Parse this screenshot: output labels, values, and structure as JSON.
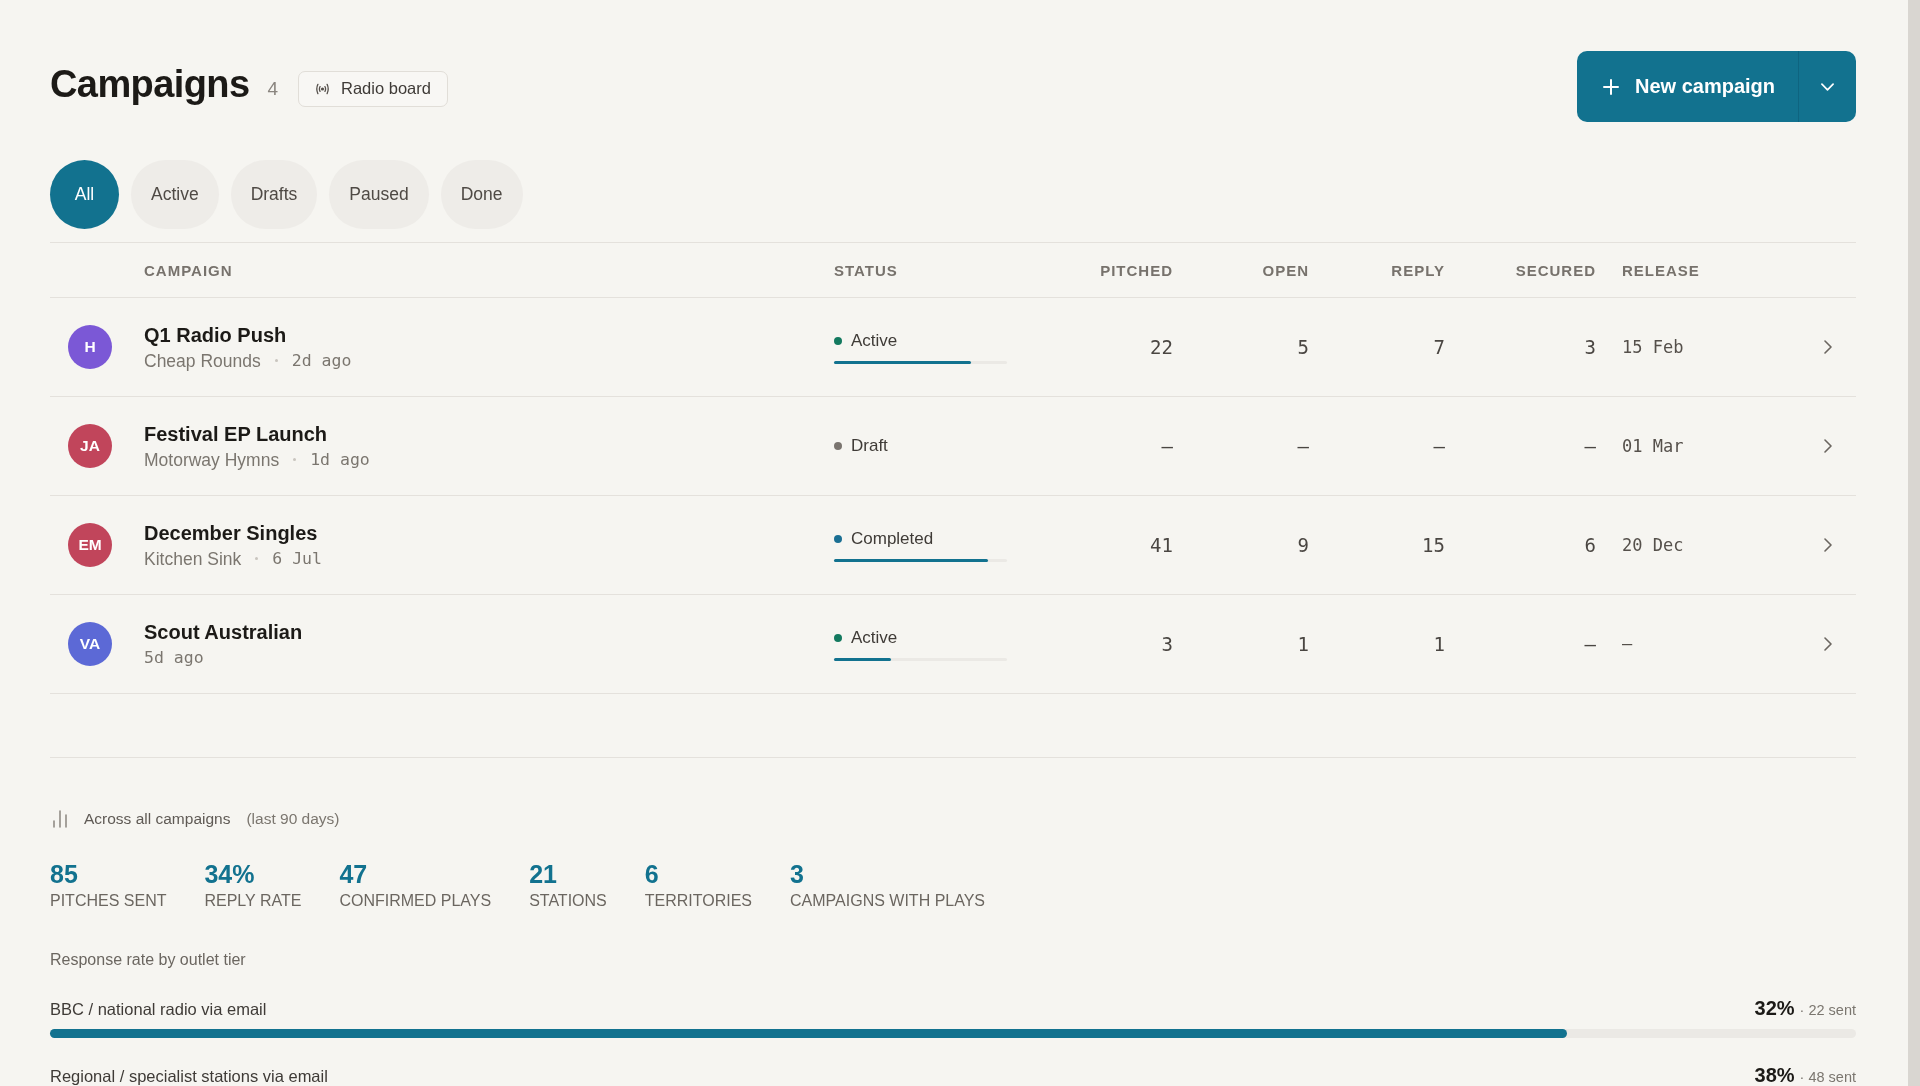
{
  "header": {
    "title": "Campaigns",
    "count": "4",
    "board_button": {
      "label": "Radio board"
    },
    "new_button": {
      "label": "New campaign"
    }
  },
  "filters": [
    {
      "label": "All",
      "selected": true
    },
    {
      "label": "Active",
      "selected": false
    },
    {
      "label": "Drafts",
      "selected": false
    },
    {
      "label": "Paused",
      "selected": false
    },
    {
      "label": "Done",
      "selected": false
    }
  ],
  "table": {
    "columns": [
      "CAMPAIGN",
      "STATUS",
      "PITCHED",
      "OPEN",
      "REPLY",
      "SECURED",
      "RELEASE"
    ],
    "rows": [
      {
        "avatar": {
          "initials": "H",
          "color": "#7b58d6"
        },
        "name": "Q1 Radio Push",
        "meta": [
          {
            "kind": "artist",
            "text": "Cheap Rounds"
          },
          {
            "kind": "time",
            "text": "2d ago"
          }
        ],
        "status": {
          "label": "Active",
          "color": "#13795f",
          "level": 0.79
        },
        "pitched": "22",
        "open": "5",
        "reply": "7",
        "secured": "3",
        "release": "15 Feb"
      },
      {
        "avatar": {
          "initials": "JA",
          "color": "#c1455b"
        },
        "name": "Festival EP Launch",
        "meta": [
          {
            "kind": "artist",
            "text": "Motorway Hymns"
          },
          {
            "kind": "time",
            "text": "1d ago"
          }
        ],
        "status": {
          "label": "Draft",
          "color": "#7a746f"
        },
        "pitched": "—",
        "open": "—",
        "reply": "—",
        "secured": "—",
        "release": "01 Mar"
      },
      {
        "avatar": {
          "initials": "EM",
          "color": "#c1455b"
        },
        "name": "December Singles",
        "meta": [
          {
            "kind": "artist",
            "text": "Kitchen Sink"
          },
          {
            "kind": "time",
            "text": "6 Jul"
          }
        ],
        "status": {
          "label": "Completed",
          "color": "#1a6f93",
          "level": 0.89
        },
        "pitched": "41",
        "open": "9",
        "reply": "15",
        "secured": "6",
        "release": "20 Dec"
      },
      {
        "avatar": {
          "initials": "VA",
          "color": "#5c69d6"
        },
        "name": "Scout Australian",
        "meta": [
          {
            "kind": "time",
            "text": "5d ago"
          }
        ],
        "status": {
          "label": "Active",
          "color": "#13795f",
          "level": 0.33
        },
        "pitched": "3",
        "open": "1",
        "reply": "1",
        "secured": "—",
        "release": "–"
      }
    ]
  },
  "summary": {
    "title": "Across all campaigns",
    "period": "(last 90 days)",
    "stats": [
      {
        "value": "85",
        "label": "PITCHES SENT"
      },
      {
        "value": "34%",
        "label": "REPLY RATE"
      },
      {
        "value": "47",
        "label": "CONFIRMED PLAYS"
      },
      {
        "value": "21",
        "label": "STATIONS"
      },
      {
        "value": "6",
        "label": "TERRITORIES"
      },
      {
        "value": "3",
        "label": "CAMPAIGNS WITH PLAYS"
      }
    ],
    "tiers_title": "Response rate by outlet tier",
    "tiers": [
      {
        "label": "BBC / national radio via email",
        "rate": "32%",
        "sent": "· 22 sent",
        "level": 0.84
      },
      {
        "label": "Regional / specialist stations via email",
        "rate": "38%",
        "sent": "· 48 sent"
      }
    ]
  }
}
